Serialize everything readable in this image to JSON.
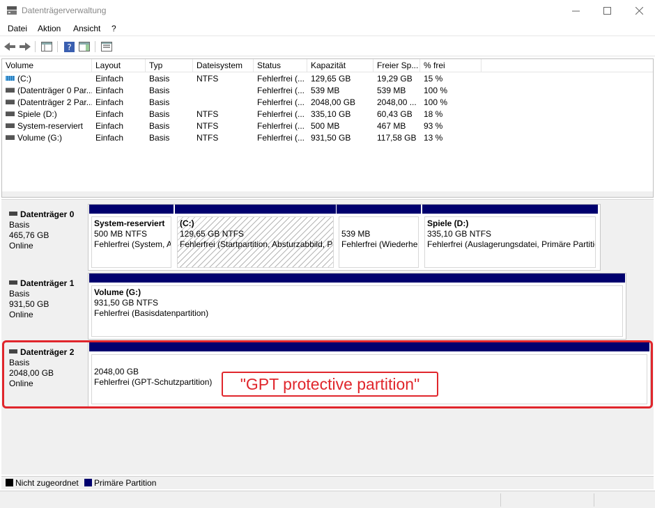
{
  "window": {
    "title": "Datenträgerverwaltung"
  },
  "menu": [
    "Datei",
    "Aktion",
    "Ansicht",
    "?"
  ],
  "volume_list": {
    "columns": [
      "Volume",
      "Layout",
      "Typ",
      "Dateisystem",
      "Status",
      "Kapazität",
      "Freier Sp...",
      "% frei"
    ],
    "rows": [
      {
        "icon": "windows-volume-icon",
        "cells": [
          "(C:)",
          "Einfach",
          "Basis",
          "NTFS",
          "Fehlerfrei (...",
          "129,65 GB",
          "19,29 GB",
          "15 %"
        ]
      },
      {
        "icon": "drive-icon",
        "cells": [
          "(Datenträger 0 Par...",
          "Einfach",
          "Basis",
          "",
          "Fehlerfrei (...",
          "539 MB",
          "539 MB",
          "100 %"
        ]
      },
      {
        "icon": "drive-icon",
        "cells": [
          "(Datenträger 2 Par...",
          "Einfach",
          "Basis",
          "",
          "Fehlerfrei (...",
          "2048,00 GB",
          "2048,00 ...",
          "100 %"
        ]
      },
      {
        "icon": "drive-icon",
        "cells": [
          "Spiele (D:)",
          "Einfach",
          "Basis",
          "NTFS",
          "Fehlerfrei (...",
          "335,10 GB",
          "60,43 GB",
          "18 %"
        ]
      },
      {
        "icon": "drive-icon",
        "cells": [
          "System-reserviert",
          "Einfach",
          "Basis",
          "NTFS",
          "Fehlerfrei (...",
          "500 MB",
          "467 MB",
          "93 %"
        ]
      },
      {
        "icon": "drive-icon",
        "cells": [
          "Volume (G:)",
          "Einfach",
          "Basis",
          "NTFS",
          "Fehlerfrei (...",
          "931,50 GB",
          "117,58 GB",
          "13 %"
        ]
      }
    ]
  },
  "disks": [
    {
      "name": "Datenträger 0",
      "type": "Basis",
      "size": "465,76 GB",
      "state": "Online",
      "partitions": [
        {
          "name": "System-reserviert",
          "detail": "500 MB NTFS",
          "status": "Fehlerfrei (System, Aktiv, Primäre Partition)"
        },
        {
          "name": "(C:)",
          "detail": "129,65 GB NTFS",
          "status": "Fehlerfrei (Startpartition, Absturzabbild, Primäre Partition)"
        },
        {
          "name": "",
          "detail": "539 MB",
          "status": "Fehlerfrei (Wiederherstellungspartition)"
        },
        {
          "name": "Spiele  (D:)",
          "detail": "335,10 GB NTFS",
          "status": "Fehlerfrei (Auslagerungsdatei, Primäre Partition)"
        }
      ]
    },
    {
      "name": "Datenträger 1",
      "type": "Basis",
      "size": "931,50 GB",
      "state": "Online",
      "partitions": [
        {
          "name": "Volume  (G:)",
          "detail": "931,50 GB NTFS",
          "status": "Fehlerfrei (Basisdatenpartition)"
        }
      ]
    },
    {
      "name": "Datenträger 2",
      "type": "Basis",
      "size": "2048,00 GB",
      "state": "Online",
      "partitions": [
        {
          "name": "",
          "detail": "2048,00 GB",
          "status": "Fehlerfrei (GPT-Schutzpartition)"
        }
      ]
    }
  ],
  "annotation": {
    "text": "\"GPT protective partition\"",
    "color": "#e0262c"
  },
  "legend": [
    {
      "label": "Nicht zugeordnet",
      "color": "#000000"
    },
    {
      "label": "Primäre Partition",
      "color": "#00006e"
    }
  ]
}
